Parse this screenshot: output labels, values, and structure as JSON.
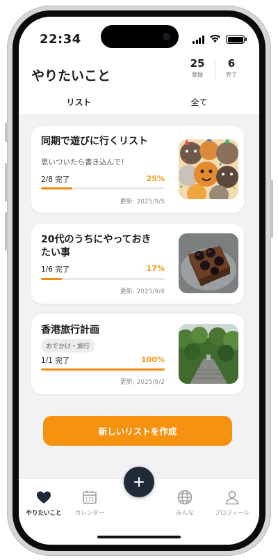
{
  "status_bar": {
    "time": "22:34"
  },
  "header": {
    "title": "やりたいこと",
    "stats": [
      {
        "value": "25",
        "label": "登録"
      },
      {
        "value": "6",
        "label": "完了"
      }
    ]
  },
  "tabs": [
    {
      "label": "リスト",
      "active": true
    },
    {
      "label": "全て",
      "active": false
    }
  ],
  "lists": [
    {
      "title": "同期で遊びに行くリスト",
      "description": "思いついたら書き込んで！",
      "progress_text": "2/8 完了",
      "percent_label": "25%",
      "progress": 0.25,
      "updated": "更新: 2025/9/5",
      "thumbnail": "cartoon-cats-party-image"
    },
    {
      "title": "20代のうちにやっておきたい事",
      "progress_text": "1/6 完了",
      "percent_label": "17%",
      "progress": 0.17,
      "updated": "更新: 2025/9/4",
      "thumbnail": "chocolate-cake-image"
    },
    {
      "title": "香港旅行計画",
      "tag": "おでかけ・旅行",
      "progress_text": "1/1 完了",
      "percent_label": "100%",
      "progress": 1.0,
      "updated": "更新: 2025/9/2",
      "thumbnail": "forest-path-image"
    }
  ],
  "create_button": {
    "label": "新しいリストを作成"
  },
  "bottom_nav": [
    {
      "label": "やりたいこと",
      "icon": "heart-icon",
      "active": true
    },
    {
      "label": "カレンダー",
      "icon": "calendar-icon",
      "active": false
    },
    {
      "label": "みんな",
      "icon": "globe-icon",
      "active": false
    },
    {
      "label": "プロフィール",
      "icon": "person-icon",
      "active": false
    }
  ],
  "fab": {
    "icon": "plus-icon"
  },
  "colors": {
    "accent": "#f59311",
    "fab": "#212a38",
    "background": "#f2f2f4"
  }
}
